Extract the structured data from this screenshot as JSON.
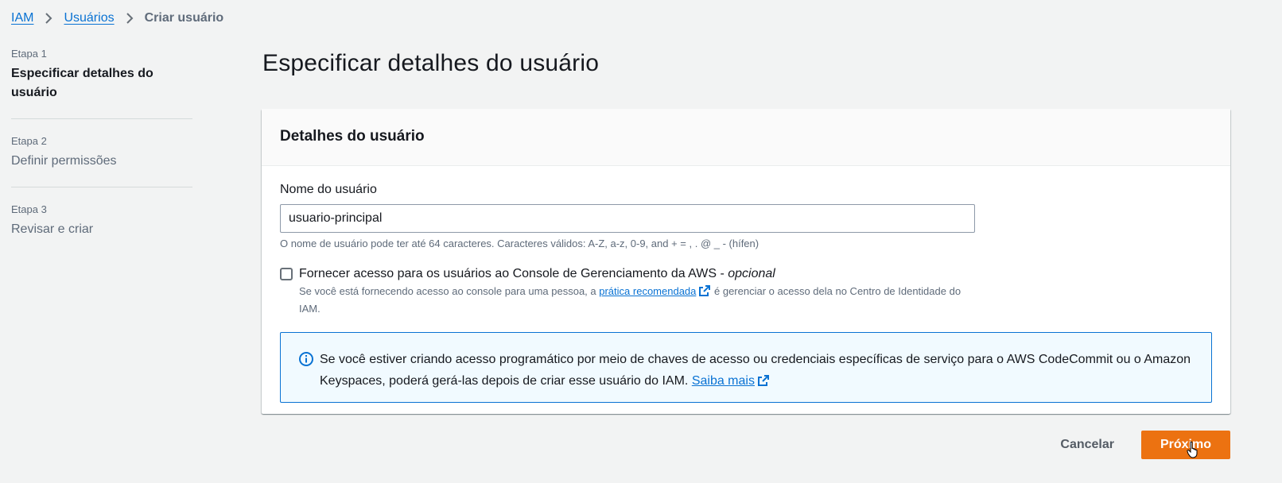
{
  "breadcrumb": {
    "items": [
      {
        "label": "IAM"
      },
      {
        "label": "Usuários"
      }
    ],
    "current": "Criar usuário"
  },
  "steps": [
    {
      "number": "Etapa 1",
      "title": "Especificar detalhes do usuário",
      "active": true
    },
    {
      "number": "Etapa 2",
      "title": "Definir permissões",
      "active": false
    },
    {
      "number": "Etapa 3",
      "title": "Revisar e criar",
      "active": false
    }
  ],
  "page": {
    "title": "Especificar detalhes do usuário"
  },
  "user_details": {
    "header": "Detalhes do usuário",
    "username_label": "Nome do usuário",
    "username_value": "usuario-principal",
    "username_constraint": "O nome de usuário pode ter até 64 caracteres. Caracteres válidos: A-Z, a-z, 0-9, and + = , . @ _ - (hífen)",
    "console_access": {
      "checked": false,
      "label": "Fornecer acesso para os usuários ao Console de Gerenciamento da AWS - ",
      "label_optional": "opcional",
      "desc_before": "Se você está fornecendo acesso ao console para uma pessoa, a ",
      "desc_link": "prática recomendada",
      "desc_after": " é gerenciar o acesso dela no Centro de Identidade do IAM."
    },
    "info_alert": {
      "text": "Se você estiver criando acesso programático por meio de chaves de acesso ou credenciais específicas de serviço para o AWS CodeCommit ou o Amazon Keyspaces, poderá gerá-las depois de criar esse usuário do IAM. ",
      "link": "Saiba mais"
    }
  },
  "actions": {
    "cancel_label": "Cancelar",
    "next_label": "Próximo"
  },
  "colors": {
    "link": "#0972d3",
    "primary": "#ec7211",
    "background": "#f2f3f3",
    "info_bg": "#f1faff"
  },
  "icons": {
    "breadcrumb_separator": "chevron-right-icon",
    "external_link": "external-link-icon",
    "info": "info-icon",
    "cursor": "hand-pointer-icon"
  }
}
